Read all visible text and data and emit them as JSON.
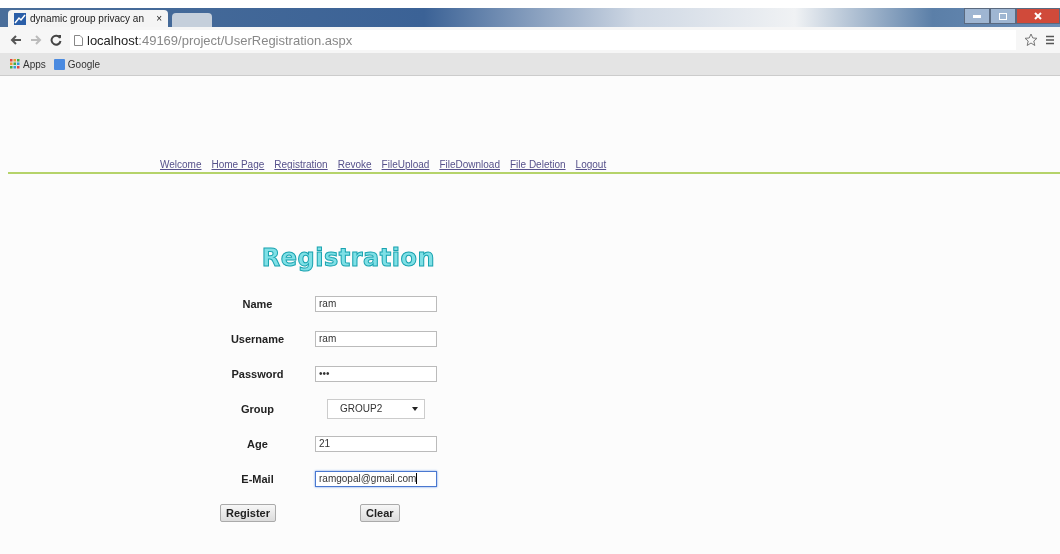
{
  "browser": {
    "tab_title": "dynamic group privacy an",
    "tab_close": "×",
    "url_host": "localhost",
    "url_path": ":49169/project/UserRegistration.aspx",
    "bookmarks": [
      "Apps",
      "Google"
    ]
  },
  "nav": [
    "Welcome",
    "Home Page",
    "Registration",
    "Revoke",
    "FileUpload",
    "FileDownload",
    "File Deletion",
    "Logout"
  ],
  "form": {
    "title": "Registration",
    "fields": [
      {
        "label": "Name",
        "kind": "text",
        "value": "ram",
        "focused": false
      },
      {
        "label": "Username",
        "kind": "text",
        "value": "ram",
        "focused": false
      },
      {
        "label": "Password",
        "kind": "password",
        "value": "•••",
        "focused": false
      },
      {
        "label": "Group",
        "kind": "select",
        "value": "GROUP2",
        "focused": false
      },
      {
        "label": "Age",
        "kind": "text",
        "value": "21",
        "focused": false
      },
      {
        "label": "E-Mail",
        "kind": "text",
        "value": "ramgopal@gmail.com",
        "focused": true
      }
    ],
    "buttons": [
      "Register",
      "Clear"
    ]
  }
}
